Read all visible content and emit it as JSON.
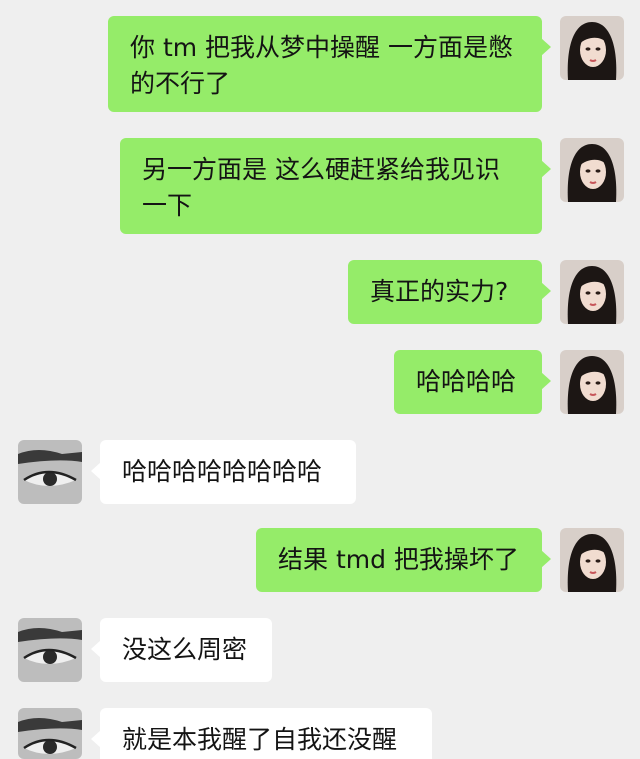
{
  "messages": [
    {
      "side": "right",
      "text": "你 tm 把我从梦中操醒 一方面是憋的不行了"
    },
    {
      "side": "right",
      "text": "另一方面是 这么硬赶紧给我见识一下"
    },
    {
      "side": "right",
      "text": "真正的实力?"
    },
    {
      "side": "right",
      "text": "哈哈哈哈"
    },
    {
      "side": "left",
      "text": "哈哈哈哈哈哈哈哈"
    },
    {
      "side": "right",
      "text": "结果 tmd 把我操坏了"
    },
    {
      "side": "left",
      "text": "没这么周密"
    },
    {
      "side": "left",
      "text": "就是本我醒了自我还没醒"
    }
  ],
  "colors": {
    "background": "#efefef",
    "outgoing_bubble": "#95ec69",
    "incoming_bubble": "#ffffff",
    "text": "#141414"
  },
  "icons": {
    "self_avatar": "woman-portrait-avatar",
    "other_avatar": "eye-closeup-avatar"
  }
}
